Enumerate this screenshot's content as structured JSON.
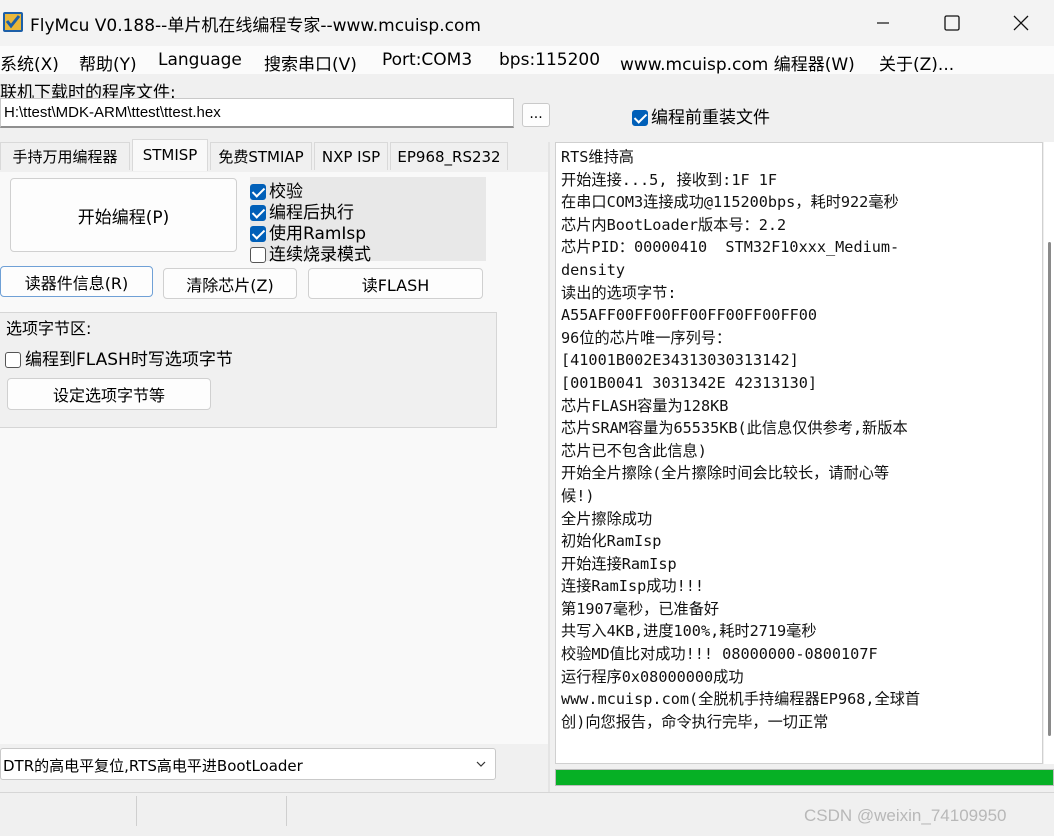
{
  "window": {
    "title": "FlyMcu V0.188--单片机在线编程专家--www.mcuisp.com",
    "controls": [
      "minimize",
      "maximize",
      "close"
    ]
  },
  "menu": {
    "items": [
      "系统(X)",
      "帮助(Y)",
      "Language",
      "搜索串口(V)",
      "Port:COM3",
      "bps:115200",
      "www.mcuisp.com 编程器(W)",
      "关于(Z)..."
    ]
  },
  "file": {
    "label": "联机下载时的程序文件:",
    "path": "H:\\ttest\\MDK-ARM\\ttest\\ttest.hex",
    "browse_label": "...",
    "reload_label": "编程前重装文件",
    "reload_checked": true
  },
  "tabs": {
    "items": [
      "手持万用编程器",
      "STMISP",
      "免费STMIAP",
      "NXP ISP",
      "EP968_RS232"
    ],
    "active": "STMISP"
  },
  "program": {
    "start_label": "开始编程(P)",
    "options": [
      {
        "label": "校验",
        "checked": true
      },
      {
        "label": "编程后执行",
        "checked": true
      },
      {
        "label": "使用RamIsp",
        "checked": true
      },
      {
        "label": "连续烧录模式",
        "checked": false
      }
    ],
    "read_info_label": "读器件信息(R)",
    "erase_label": "清除芯片(Z)",
    "read_flash_label": "读FLASH"
  },
  "option_bytes": {
    "title": "选项字节区:",
    "write_label": "编程到FLASH时写选项字节",
    "write_checked": false,
    "set_label": "设定选项字节等"
  },
  "reset_mode": {
    "selected": "DTR的高电平复位,RTS高电平进BootLoader"
  },
  "log": {
    "lines": [
      "RTS维持高",
      "开始连接...5, 接收到:1F 1F",
      "在串口COM3连接成功@115200bps，耗时922毫秒",
      "芯片内BootLoader版本号：2.2",
      "芯片PID：00000410  STM32F10xxx_Medium-",
      "density",
      "读出的选项字节:",
      "A55AFF00FF00FF00FF00FF00FF00",
      "96位的芯片唯一序列号：",
      "[41001B002E34313030313142]",
      "[001B0041 3031342E 42313130]",
      "芯片FLASH容量为128KB",
      "芯片SRAM容量为65535KB(此信息仅供参考,新版本",
      "芯片已不包含此信息)",
      "开始全片擦除(全片擦除时间会比较长，请耐心等",
      "候!)",
      "全片擦除成功",
      "初始化RamIsp",
      "开始连接RamIsp",
      "连接RamIsp成功!!!",
      "第1907毫秒，已准备好",
      "共写入4KB,进度100%,耗时2719毫秒",
      "校验MD值比对成功!!! 08000000-0800107F",
      "运行程序0x08000000成功",
      "www.mcuisp.com(全脱机手持编程器EP968,全球首",
      "创)向您报告，命令执行完毕，一切正常"
    ]
  },
  "progress": {
    "percent": 100,
    "color": "#06b025"
  },
  "watermark": "CSDN @weixin_74109950"
}
